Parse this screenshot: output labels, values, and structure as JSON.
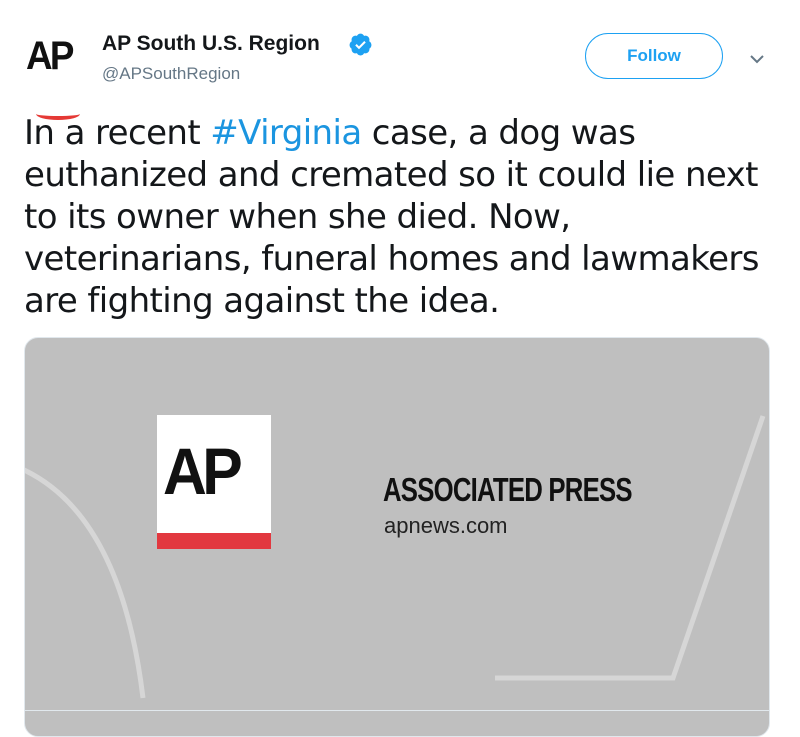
{
  "account": {
    "avatar_text": "AP",
    "display_name": "AP South U.S. Region",
    "handle": "@APSouthRegion",
    "verified": true
  },
  "actions": {
    "follow_label": "Follow"
  },
  "tweet": {
    "text_before": "In a recent ",
    "hashtag": "#Virginia",
    "text_after": " case, a dog was euthanized and cremated so it could lie next to its owner when she died. Now, veterinarians, funeral homes and lawmakers are fighting against the idea."
  },
  "card": {
    "logo_text": "AP",
    "brand": "ASSOCIATED PRESS",
    "domain": "apnews.com"
  },
  "colors": {
    "accent": "#1da1f2",
    "hashtag": "#1b95e0",
    "ap_red": "#e2383f",
    "card_bg": "#bfbfbf"
  }
}
